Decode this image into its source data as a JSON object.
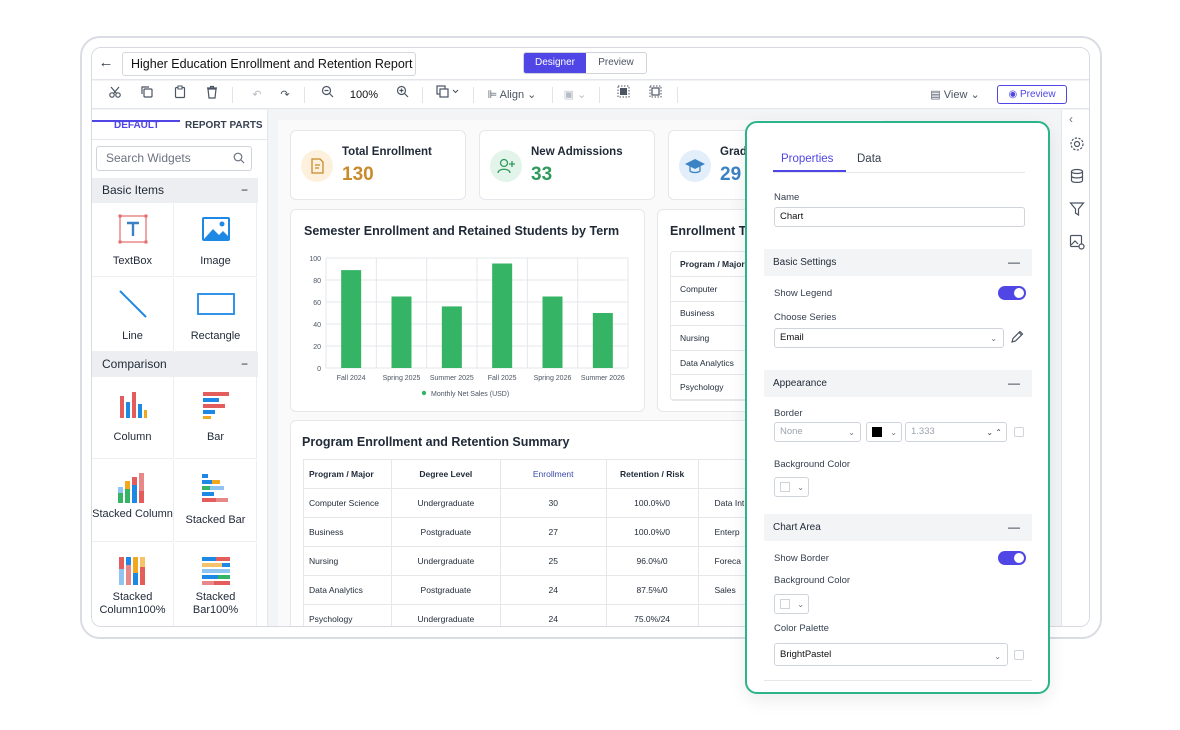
{
  "app": {
    "report_name": "Higher Education Enrollment and Retention Report",
    "mode_tabs": [
      "Designer",
      "Preview"
    ],
    "toolbar": {
      "zoom": "100%",
      "align": "Align",
      "view": "View",
      "preview": "Preview"
    }
  },
  "left_panel": {
    "tabs": [
      "DEFAULT",
      "REPORT PARTS"
    ],
    "search_placeholder": "Search Widgets",
    "groups": [
      {
        "title": "Basic Items",
        "items": [
          "TextBox",
          "Image",
          "Line",
          "Rectangle"
        ]
      },
      {
        "title": "Comparison",
        "items": [
          "Column",
          "Bar",
          "Stacked Column",
          "Stacked Bar",
          "Stacked Column100%",
          "Stacked Bar100%"
        ]
      }
    ]
  },
  "kpis": [
    {
      "title": "Total Enrollment",
      "value": "130",
      "color": "#c98a2b"
    },
    {
      "title": "New Admissions",
      "value": "33",
      "color": "#2e9a5b"
    },
    {
      "title": "Grad",
      "value": "29",
      "color": "#3b82c4"
    }
  ],
  "chart_section": {
    "title": "Semester Enrollment and Retained Students by Term"
  },
  "chart_data": {
    "type": "bar",
    "title": "Semester Enrollment and Retained Students by Term",
    "categories": [
      "Fall 2024",
      "Spring 2025",
      "Summer 2025",
      "Fall 2025",
      "Spring 2026",
      "Summer 2026"
    ],
    "series": [
      {
        "name": "Monthly Net Sales (USD)",
        "values": [
          89,
          65,
          56,
          95,
          65,
          50
        ],
        "color": "#34b464"
      }
    ],
    "yticks": [
      "0",
      "20",
      "40",
      "60",
      "80",
      "100"
    ],
    "ylim": [
      0,
      100
    ],
    "grid": true,
    "legend": "bottom"
  },
  "enrollment_table": {
    "title": "Enrollment Ta",
    "header": "Program / Major",
    "rows": [
      "Computer",
      "Business",
      "Nursing",
      "Data Analytics",
      "Psychology"
    ]
  },
  "summary": {
    "title": "Program Enrollment and Retention Summary",
    "columns": [
      "Program / Major",
      "Degree Level",
      "Enrollment",
      "Retention / Risk"
    ],
    "rows": [
      [
        "Computer Science",
        "Undergraduate",
        "30",
        "100.0%/0",
        "Data Int"
      ],
      [
        "Business",
        "Postgraduate",
        "27",
        "100.0%/0",
        "Enterp"
      ],
      [
        "Nursing",
        "Undergraduate",
        "25",
        "96.0%/0",
        "Foreca"
      ],
      [
        "Data Analytics",
        "Postgraduate",
        "24",
        "87.5%/0",
        "Sales"
      ],
      [
        "Psychology",
        "Undergraduate",
        "24",
        "75.0%/24",
        ""
      ]
    ]
  },
  "properties": {
    "tabs": [
      "Properties",
      "Data"
    ],
    "name_label": "Name",
    "name_value": "Chart",
    "basic_settings": "Basic Settings",
    "show_legend": "Show Legend",
    "choose_series": "Choose Series",
    "series_value": "Email",
    "appearance": "Appearance",
    "border": "Border",
    "border_style": "None",
    "border_width": "1.333",
    "bg_color": "Background Color",
    "chart_area": "Chart Area",
    "show_border": "Show Border",
    "bg_color2": "Background Color",
    "palette_label": "Color Palette",
    "palette_value": "BrightPastel"
  }
}
